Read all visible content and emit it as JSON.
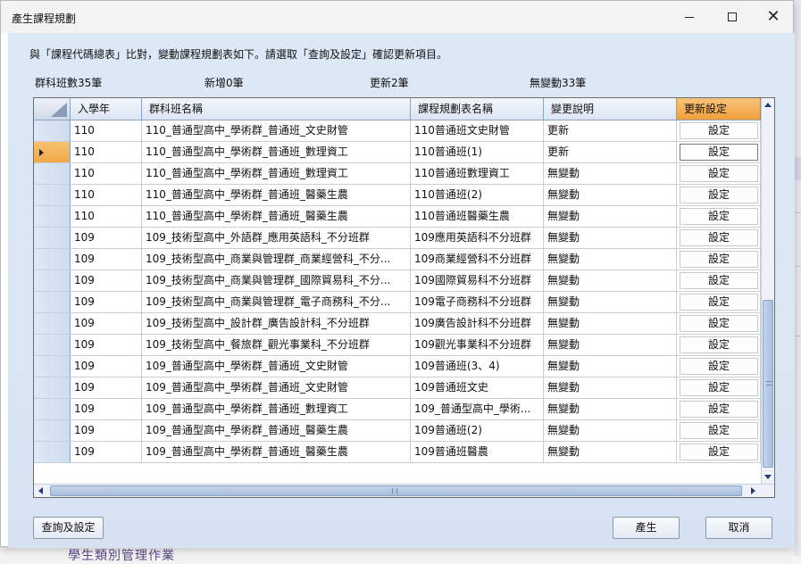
{
  "window": {
    "title": "產生課程規劃"
  },
  "titlebar": {
    "minimize_glyph": "—",
    "maximize_glyph": "□",
    "close_glyph": "✕"
  },
  "instruction": "與「課程代碼總表」比對，變動課程規劃表如下。請選取「查詢及設定」確認更新項目。",
  "stats": {
    "total": "群科班數35筆",
    "new": "新增0筆",
    "updated": "更新2筆",
    "unchanged": "無變動33筆"
  },
  "grid": {
    "columns": [
      "入學年",
      "群科班名稱",
      "課程規劃表名稱",
      "變更說明",
      "更新設定"
    ],
    "current_row": 1,
    "rows": [
      {
        "year": "110",
        "class_name": "110_普通型高中_學術群_普通班_文史財管",
        "plan_name": "110普通班文史財管",
        "change": "更新",
        "action": "設定"
      },
      {
        "year": "110",
        "class_name": "110_普通型高中_學術群_普通班_數理資工",
        "plan_name": "110普通班(1)",
        "change": "更新",
        "action": "設定"
      },
      {
        "year": "110",
        "class_name": "110_普通型高中_學術群_普通班_數理資工",
        "plan_name": "110普通班數理資工",
        "change": "無變動",
        "action": "設定"
      },
      {
        "year": "110",
        "class_name": "110_普通型高中_學術群_普通班_醫藥生農",
        "plan_name": "110普通班(2)",
        "change": "無變動",
        "action": "設定"
      },
      {
        "year": "110",
        "class_name": "110_普通型高中_學術群_普通班_醫藥生農",
        "plan_name": "110普通班醫藥生農",
        "change": "無變動",
        "action": "設定"
      },
      {
        "year": "109",
        "class_name": "109_技術型高中_外語群_應用英語科_不分班群",
        "plan_name": "109應用英語科不分班群",
        "change": "無變動",
        "action": "設定"
      },
      {
        "year": "109",
        "class_name": "109_技術型高中_商業與管理群_商業經營科_不分...",
        "plan_name": "109商業經營科不分班群",
        "change": "無變動",
        "action": "設定"
      },
      {
        "year": "109",
        "class_name": "109_技術型高中_商業與管理群_國際貿易科_不分...",
        "plan_name": "109國際貿易科不分班群",
        "change": "無變動",
        "action": "設定"
      },
      {
        "year": "109",
        "class_name": "109_技術型高中_商業與管理群_電子商務科_不分...",
        "plan_name": "109電子商務科不分班群",
        "change": "無變動",
        "action": "設定"
      },
      {
        "year": "109",
        "class_name": "109_技術型高中_設計群_廣告設計科_不分班群",
        "plan_name": "109廣告設計科不分班群",
        "change": "無變動",
        "action": "設定"
      },
      {
        "year": "109",
        "class_name": "109_技術型高中_餐旅群_觀光事業科_不分班群",
        "plan_name": "109觀光事業科不分班群",
        "change": "無變動",
        "action": "設定"
      },
      {
        "year": "109",
        "class_name": "109_普通型高中_學術群_普通班_文史財管",
        "plan_name": "109普通班(3、4)",
        "change": "無變動",
        "action": "設定"
      },
      {
        "year": "109",
        "class_name": "109_普通型高中_學術群_普通班_文史財管",
        "plan_name": "109普通班文史",
        "change": "無變動",
        "action": "設定"
      },
      {
        "year": "109",
        "class_name": "109_普通型高中_學術群_普通班_數理資工",
        "plan_name": "109_普通型高中_學術...",
        "change": "無變動",
        "action": "設定"
      },
      {
        "year": "109",
        "class_name": "109_普通型高中_學術群_普通班_醫藥生農",
        "plan_name": "109普通班(2)",
        "change": "無變動",
        "action": "設定"
      },
      {
        "year": "109",
        "class_name": "109_普通型高中_學術群_普通班_醫藥生農",
        "plan_name": "109普通班醫農",
        "change": "無變動",
        "action": "設定"
      }
    ]
  },
  "buttons": {
    "query": "查詢及設定",
    "generate": "產生",
    "cancel": "取消"
  },
  "background": {
    "bottom_text": "學生類別管理作業",
    "side_glyph": "平台"
  },
  "colors": {
    "accent_orange": "#f0a03c",
    "grid_border": "#6b6b6b",
    "client_bg": "#dde8f6"
  }
}
